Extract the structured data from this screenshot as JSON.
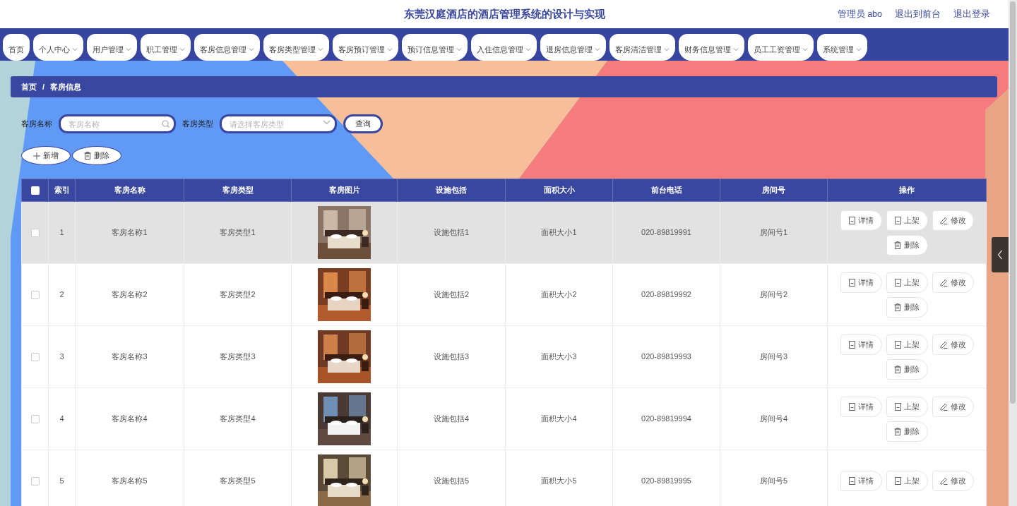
{
  "header": {
    "title": "东莞汉庭酒店的酒店管理系统的设计与实现",
    "links": [
      "管理员 abo",
      "退出到前台",
      "退出登录"
    ]
  },
  "nav": [
    {
      "label": "首页",
      "dropdown": false
    },
    {
      "label": "个人中心",
      "dropdown": true
    },
    {
      "label": "用户管理",
      "dropdown": true
    },
    {
      "label": "职工管理",
      "dropdown": true
    },
    {
      "label": "客房信息管理",
      "dropdown": true
    },
    {
      "label": "客房类型管理",
      "dropdown": true
    },
    {
      "label": "客房预订管理",
      "dropdown": true
    },
    {
      "label": "预订信息管理",
      "dropdown": true
    },
    {
      "label": "入住信息管理",
      "dropdown": true
    },
    {
      "label": "退房信息管理",
      "dropdown": true
    },
    {
      "label": "客房清洁管理",
      "dropdown": true
    },
    {
      "label": "财务信息管理",
      "dropdown": true
    },
    {
      "label": "员工工资管理",
      "dropdown": true
    },
    {
      "label": "系统管理",
      "dropdown": true
    }
  ],
  "breadcrumb": {
    "items": [
      "首页",
      "客房信息"
    ],
    "separator": "/"
  },
  "filters": [
    {
      "kind": "search",
      "label": "客房名称",
      "placeholder": "客房名称"
    },
    {
      "kind": "select",
      "label": "客房类型",
      "placeholder": "请选择客房类型"
    }
  ],
  "query_button": "查询",
  "toolbar": [
    {
      "kind": "add",
      "label": "新增"
    },
    {
      "kind": "delete",
      "label": "删除"
    }
  ],
  "table": {
    "header_checkbox": {
      "checked": false
    },
    "columns": [
      "索引",
      "客房名称",
      "客房类型",
      "客房图片",
      "设施包括",
      "面积大小",
      "前台电话",
      "房间号",
      "操作"
    ],
    "rows": [
      {
        "index": "1",
        "name": "客房名称1",
        "type": "客房类型1",
        "photo": {
          "kind": "picture"
        },
        "facilities": "设施包括1",
        "area": "面积大小1",
        "phone": "020-89819991",
        "room_no": "房间号1",
        "checked": false,
        "highlighted": true,
        "actions": [
          {
            "kind": "detail",
            "label": "详情"
          },
          {
            "kind": "detail",
            "label": "上架"
          },
          {
            "kind": "edit",
            "label": "修改"
          },
          {
            "kind": "delete",
            "label": "删除"
          }
        ]
      },
      {
        "index": "2",
        "name": "客房名称2",
        "type": "客房类型2",
        "photo": {
          "kind": "picture"
        },
        "facilities": "设施包括2",
        "area": "面积大小2",
        "phone": "020-89819992",
        "room_no": "房间号2",
        "checked": false,
        "highlighted": false,
        "actions": [
          {
            "kind": "detail",
            "label": "详情"
          },
          {
            "kind": "detail",
            "label": "上架"
          },
          {
            "kind": "edit",
            "label": "修改"
          },
          {
            "kind": "delete",
            "label": "删除"
          }
        ]
      },
      {
        "index": "3",
        "name": "客房名称3",
        "type": "客房类型3",
        "photo": {
          "kind": "picture"
        },
        "facilities": "设施包括3",
        "area": "面积大小3",
        "phone": "020-89819993",
        "room_no": "房间号3",
        "checked": false,
        "highlighted": false,
        "actions": [
          {
            "kind": "detail",
            "label": "详情"
          },
          {
            "kind": "detail",
            "label": "上架"
          },
          {
            "kind": "edit",
            "label": "修改"
          },
          {
            "kind": "delete",
            "label": "删除"
          }
        ]
      },
      {
        "index": "4",
        "name": "客房名称4",
        "type": "客房类型4",
        "photo": {
          "kind": "picture"
        },
        "facilities": "设施包括4",
        "area": "面积大小4",
        "phone": "020-89819994",
        "room_no": "房间号4",
        "checked": false,
        "highlighted": false,
        "actions": [
          {
            "kind": "detail",
            "label": "详情"
          },
          {
            "kind": "detail",
            "label": "上架"
          },
          {
            "kind": "edit",
            "label": "修改"
          },
          {
            "kind": "delete",
            "label": "删除"
          }
        ]
      },
      {
        "index": "5",
        "name": "客房名称5",
        "type": "客房类型5",
        "photo": {
          "kind": "picture"
        },
        "facilities": "设施包括5",
        "area": "面积大小5",
        "phone": "020-89819995",
        "room_no": "房间号5",
        "checked": false,
        "highlighted": false,
        "actions": [
          {
            "kind": "detail",
            "label": "详情"
          },
          {
            "kind": "detail",
            "label": "上架"
          },
          {
            "kind": "edit",
            "label": "修改"
          }
        ]
      }
    ]
  }
}
